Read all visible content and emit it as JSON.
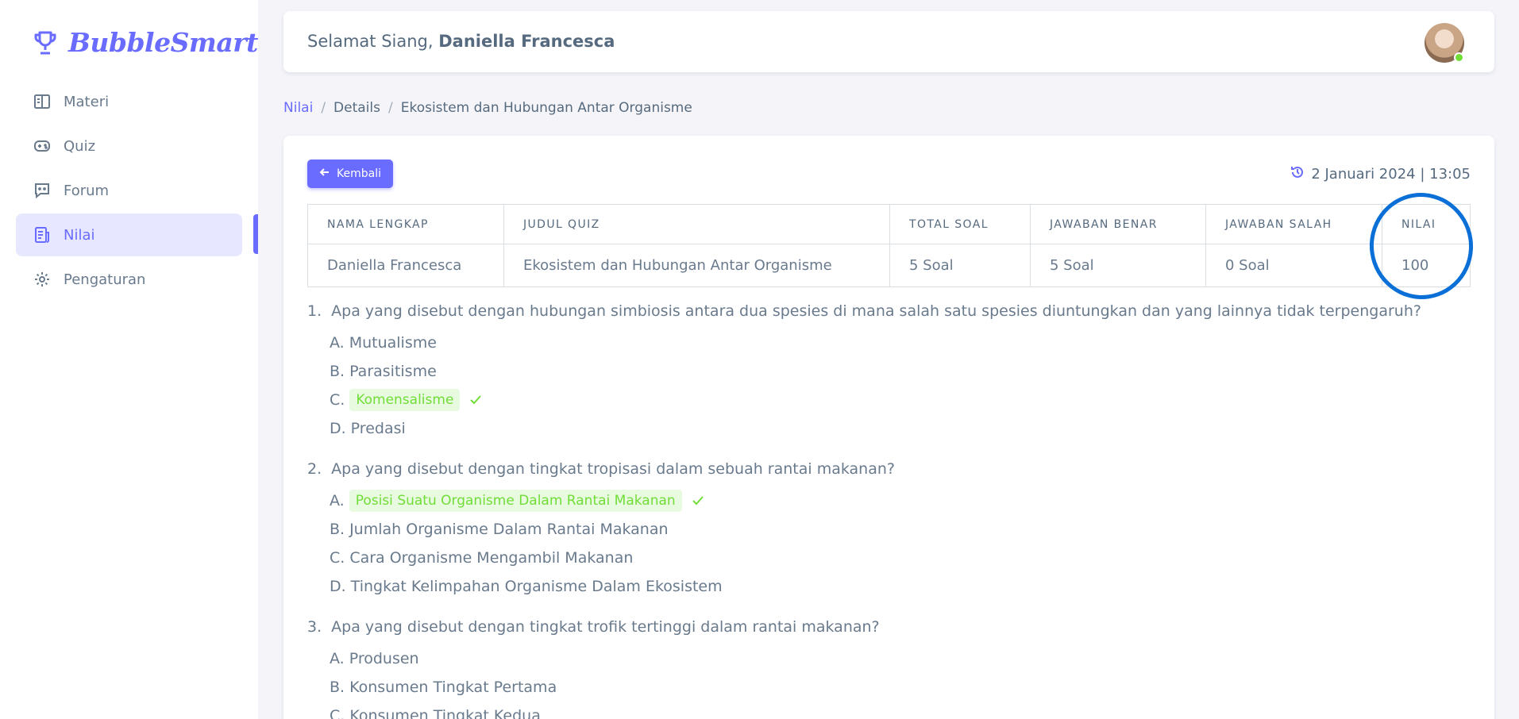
{
  "brand": {
    "name": "BubbleSmart",
    "icon": "trophy-icon",
    "color": "#696cff"
  },
  "sidebar": {
    "items": [
      {
        "label": "Materi",
        "icon": "book-icon",
        "active": false
      },
      {
        "label": "Quiz",
        "icon": "gamepad-icon",
        "active": false
      },
      {
        "label": "Forum",
        "icon": "chat-icon",
        "active": false
      },
      {
        "label": "Nilai",
        "icon": "report-icon",
        "active": true
      },
      {
        "label": "Pengaturan",
        "icon": "gear-icon",
        "active": false
      }
    ]
  },
  "header": {
    "greeting": "Selamat Siang,",
    "user_name": "Daniella Francesca",
    "avatar_status": "online"
  },
  "breadcrumb": {
    "items": [
      "Nilai",
      "Details",
      "Ekosistem dan Hubungan Antar Organisme"
    ]
  },
  "card": {
    "back_label": "Kembali",
    "date_text": "2 Januari 2024 | 13:05"
  },
  "table": {
    "headers": [
      "NAMA LENGKAP",
      "JUDUL QUIZ",
      "TOTAL SOAL",
      "JAWABAN BENAR",
      "JAWABAN SALAH",
      "NILAI"
    ],
    "row": [
      "Daniella Francesca",
      "Ekosistem dan Hubungan Antar Organisme",
      "5 Soal",
      "5 Soal",
      "0 Soal",
      "100"
    ]
  },
  "questions": [
    {
      "num": "1.",
      "text": "Apa yang disebut dengan hubungan simbiosis antara dua spesies di mana salah satu spesies diuntungkan dan yang lainnya tidak terpengaruh?",
      "options": [
        {
          "letter": "A.",
          "text": "Mutualisme",
          "correct": false
        },
        {
          "letter": "B.",
          "text": "Parasitisme",
          "correct": false
        },
        {
          "letter": "C.",
          "text": "Komensalisme",
          "correct": true
        },
        {
          "letter": "D.",
          "text": "Predasi",
          "correct": false
        }
      ]
    },
    {
      "num": "2.",
      "text": "Apa yang disebut dengan tingkat tropisasi dalam sebuah rantai makanan?",
      "options": [
        {
          "letter": "A.",
          "text": "Posisi Suatu Organisme Dalam Rantai Makanan",
          "correct": true
        },
        {
          "letter": "B.",
          "text": "Jumlah Organisme Dalam Rantai Makanan",
          "correct": false
        },
        {
          "letter": "C.",
          "text": "Cara Organisme Mengambil Makanan",
          "correct": false
        },
        {
          "letter": "D.",
          "text": "Tingkat Kelimpahan Organisme Dalam Ekosistem",
          "correct": false
        }
      ]
    },
    {
      "num": "3.",
      "text": "Apa yang disebut dengan tingkat trofik tertinggi dalam rantai makanan?",
      "options": [
        {
          "letter": "A.",
          "text": "Produsen",
          "correct": false
        },
        {
          "letter": "B.",
          "text": "Konsumen Tingkat Pertama",
          "correct": false
        },
        {
          "letter": "C.",
          "text": "Konsumen Tingkat Kedua",
          "correct": false
        }
      ]
    }
  ],
  "colors": {
    "accent": "#696cff",
    "correct": "#71dd37",
    "annotation": "#0a6fd6"
  }
}
